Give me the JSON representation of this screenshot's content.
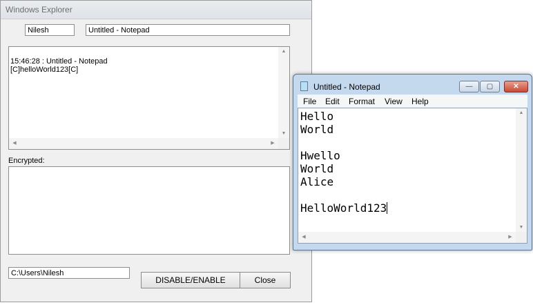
{
  "dialog": {
    "title": "Windows Explorer",
    "user_field": "Nilesh",
    "window_field": "Untitled - Notepad",
    "log_lines": [
      "15:46:28 : Untitled - Notepad",
      "[C]helloWorld123[C]"
    ],
    "encrypted_label": "Encrypted:",
    "path_field": "C:\\Users\\Nilesh",
    "disable_enable_label": "DISABLE/ENABLE",
    "close_label": "Close"
  },
  "notepad": {
    "title": "Untitled - Notepad",
    "menu": [
      "File",
      "Edit",
      "Format",
      "View",
      "Help"
    ],
    "lines": [
      "Hello",
      "World",
      "",
      "Hwello",
      "World",
      "Alice",
      "",
      "HelloWorld123"
    ]
  },
  "icons": {
    "scroll_up": "▲",
    "scroll_down": "▼",
    "scroll_left": "◀",
    "scroll_right": "▶",
    "minimize": "—",
    "maximize": "▢",
    "close": "✕"
  }
}
